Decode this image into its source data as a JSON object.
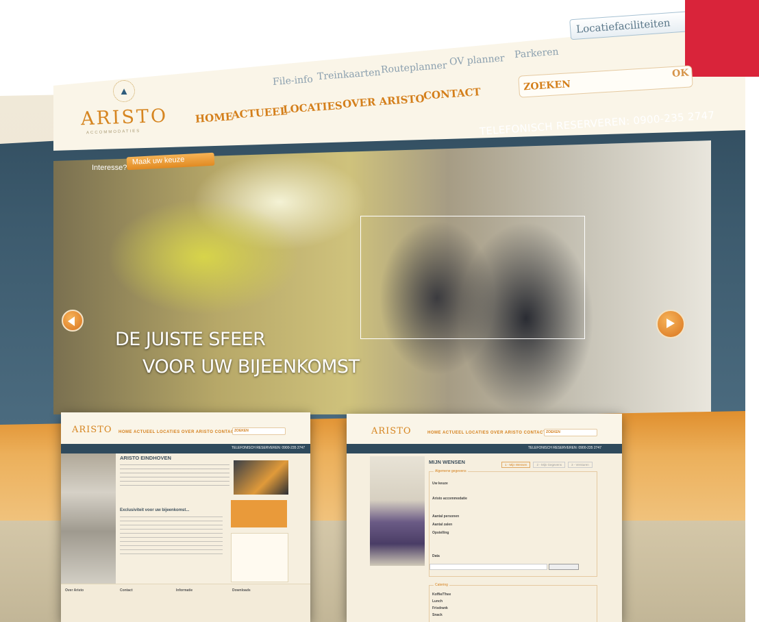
{
  "top_links": [
    "File-info",
    "Treinkaarten",
    "Routeplanner",
    "OV planner",
    "Parkeren"
  ],
  "location_select": "Locatiefaciliteiten",
  "logo": {
    "name": "ARISTO",
    "sub": "ACCOMMODATIES"
  },
  "nav": [
    "HOME",
    "ACTUEEL",
    "LOCATIES",
    "OVER ARISTO",
    "CONTACT"
  ],
  "search": {
    "label": "ZOEKEN",
    "button": "OK"
  },
  "phone": "TELEFONISCH RESERVEREN: 0900-235 2747",
  "interest": {
    "label": "Interesse?",
    "select": "Maak uw keuze"
  },
  "hero": {
    "line1": "DE JUISTE SFEER",
    "line2": "VOOR UW BIJEENKOMST"
  },
  "thumb1": {
    "logo": "ARISTO",
    "nav": "HOME ACTUEEL LOCATIES OVER ARISTO CONTACT",
    "search": "ZOEKEN",
    "phone": "TELEFONISCH RESERVEREN: 0900-235 2747",
    "heading": "ARISTO EINDHOVEN",
    "subheading": "Exclusiviteit voor uw bijeenkomst...",
    "footer_cols": [
      "Over Aristo",
      "Contact",
      "Informatie",
      "Downloads"
    ]
  },
  "thumb2": {
    "logo": "ARISTO",
    "nav": "HOME ACTUEEL LOCATIES OVER ARISTO CONTACT",
    "search": "ZOEKEN",
    "phone": "TELEFONISCH RESERVEREN: 0900-235 2747",
    "heading": "MIJN WENSEN",
    "section1": "Algemene gegevens",
    "field_choice": "Uw keuze",
    "field_accommodation": "Aristo accommodatie",
    "field_persons": "Aantal personen",
    "field_rooms": "Aantal zalen",
    "field_setup": "Opstelling",
    "field_date": "Data",
    "section2": "Catering",
    "catering": [
      "Koffie/Thee",
      "Lunch",
      "Frisdrank",
      "Snack"
    ],
    "steps": [
      "1 - Mijn Wensen",
      "2 - Mijn Gegevens",
      "3 - Versturen"
    ]
  },
  "colors": {
    "accent": "#d47f1b",
    "header_bg": "#faf5e8",
    "band": "#2f4a5c",
    "corner": "#d9243a"
  }
}
